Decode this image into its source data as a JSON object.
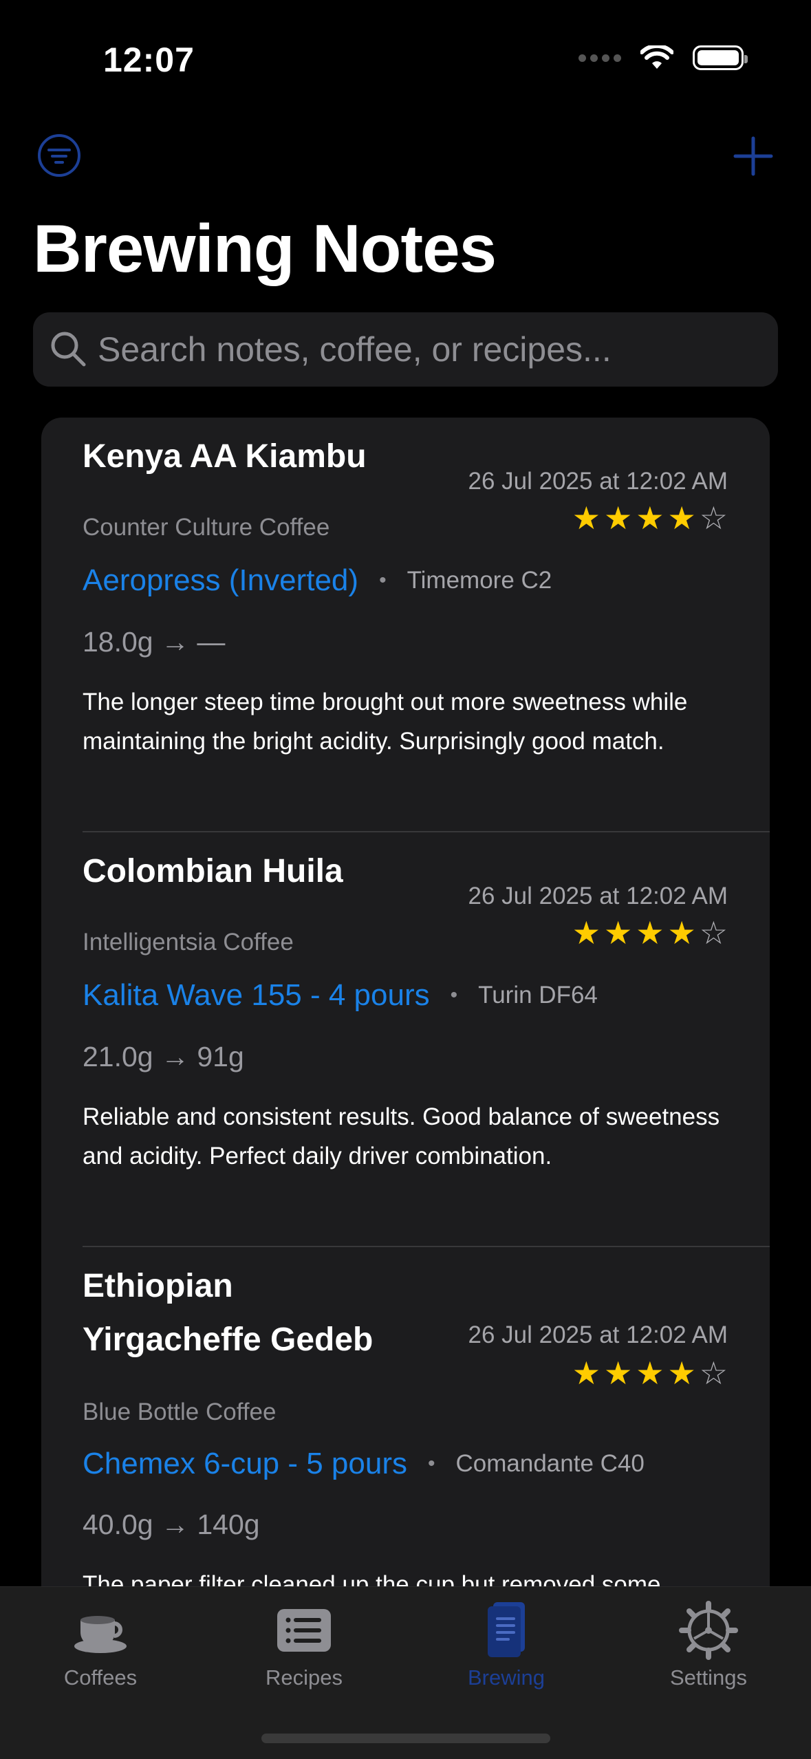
{
  "status_bar": {
    "time": "12:07"
  },
  "header": {
    "title": "Brewing Notes"
  },
  "search": {
    "placeholder": "Search notes, coffee, or recipes..."
  },
  "notes": [
    {
      "coffee": "Kenya AA Kiambu",
      "roaster": "Counter Culture Coffee",
      "date": "26 Jul 2025 at 12:02 AM",
      "rating": 4,
      "recipe": "Aeropress (Inverted)",
      "separator": "•",
      "grinder": "Timemore C2",
      "ratio": "18.0g → —",
      "text": "The longer steep time brought out more sweetness while maintaining the bright acidity. Surprisingly good match."
    },
    {
      "coffee": "Colombian Huila",
      "roaster": "Intelligentsia Coffee",
      "date": "26 Jul 2025 at 12:02 AM",
      "rating": 4,
      "recipe": "Kalita Wave 155 - 4 pours",
      "separator": "•",
      "grinder": "Turin DF64",
      "ratio": "21.0g → 91g",
      "text": "Reliable and consistent results. Good balance of sweetness and acidity. Perfect daily driver combination."
    },
    {
      "coffee_line1": "Ethiopian",
      "coffee_line2": "Yirgacheffe Gedeb",
      "roaster": "Blue Bottle Coffee",
      "date": "26 Jul 2025 at 12:02 AM",
      "rating": 4,
      "recipe": "Chemex 6-cup - 5 pours",
      "separator": "•",
      "grinder": "Comandante C40",
      "ratio": "40.0g → 140g",
      "text": "The paper filter cleaned up the cup but removed some"
    }
  ],
  "tabs": [
    {
      "label": "Coffees",
      "icon": "coffee-cup-icon",
      "active": false
    },
    {
      "label": "Recipes",
      "icon": "recipe-list-icon",
      "active": false
    },
    {
      "label": "Brewing",
      "icon": "notebook-icon",
      "active": true
    },
    {
      "label": "Settings",
      "icon": "gear-icon",
      "active": false
    }
  ],
  "colors": {
    "accent": "#1a82e8",
    "active_tab": "#1c3f96",
    "star": "#ffcc00",
    "card_bg": "#1c1c1e"
  }
}
